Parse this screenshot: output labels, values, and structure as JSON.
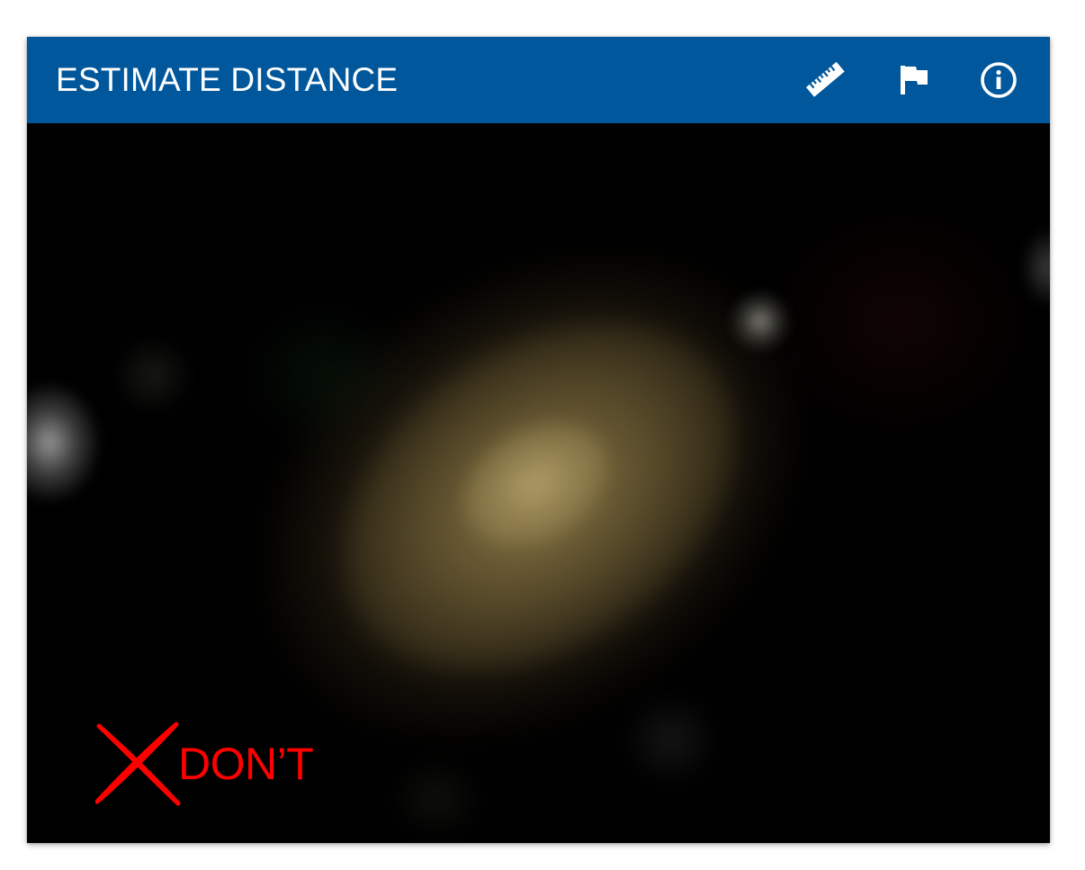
{
  "header": {
    "title": "ESTIMATE DISTANCE",
    "background_color": "#00579b",
    "icons": [
      {
        "name": "ruler-icon",
        "glyph": "ruler"
      },
      {
        "name": "flag-icon",
        "glyph": "flag"
      },
      {
        "name": "info-icon",
        "glyph": "info-circle"
      }
    ]
  },
  "viewer": {
    "subject": "galaxy",
    "annotation": {
      "mark": "x-mark",
      "text": "DON’T",
      "color": "#ff0000"
    }
  }
}
